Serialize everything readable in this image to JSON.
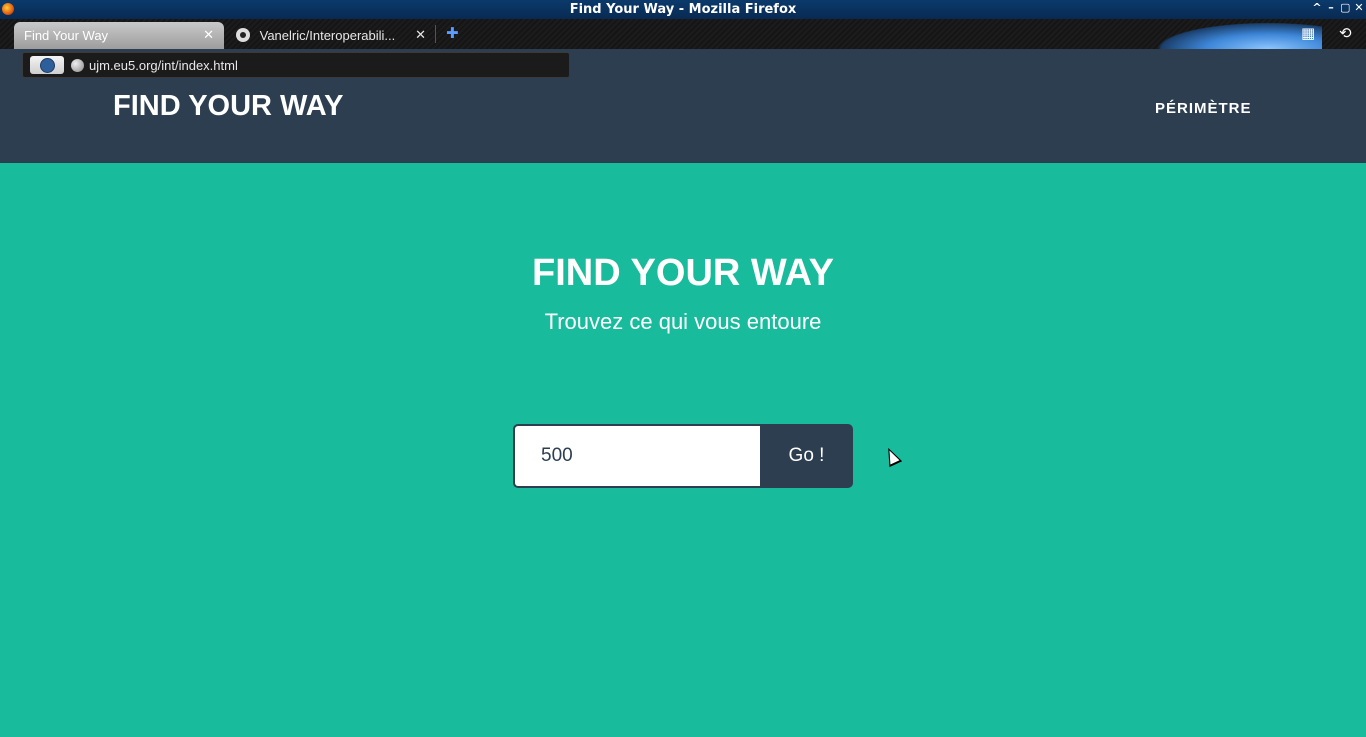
{
  "window": {
    "title": "Find Your Way - Mozilla Firefox",
    "buttons": [
      "^",
      "–",
      "▢",
      "✕"
    ]
  },
  "tabs": [
    {
      "label": "Find Your Way",
      "close": "✕"
    },
    {
      "label": "Vanelric/Interoperabili...",
      "close": "✕"
    }
  ],
  "newtab_symbol": "✚",
  "toolbar_icons": {
    "layout": "▦",
    "history": "⟲"
  },
  "urlbar": {
    "url": "ujm.eu5.org/int/index.html"
  },
  "navbar": {
    "brand": "FIND YOUR WAY",
    "link": "PÉRIMÈTRE"
  },
  "hero": {
    "title": "FIND YOUR WAY",
    "subtitle": "Trouvez ce qui vous entoure"
  },
  "search": {
    "value": "500",
    "button": "Go !"
  },
  "colors": {
    "primary": "#2c3e50",
    "accent": "#18bc9c"
  }
}
